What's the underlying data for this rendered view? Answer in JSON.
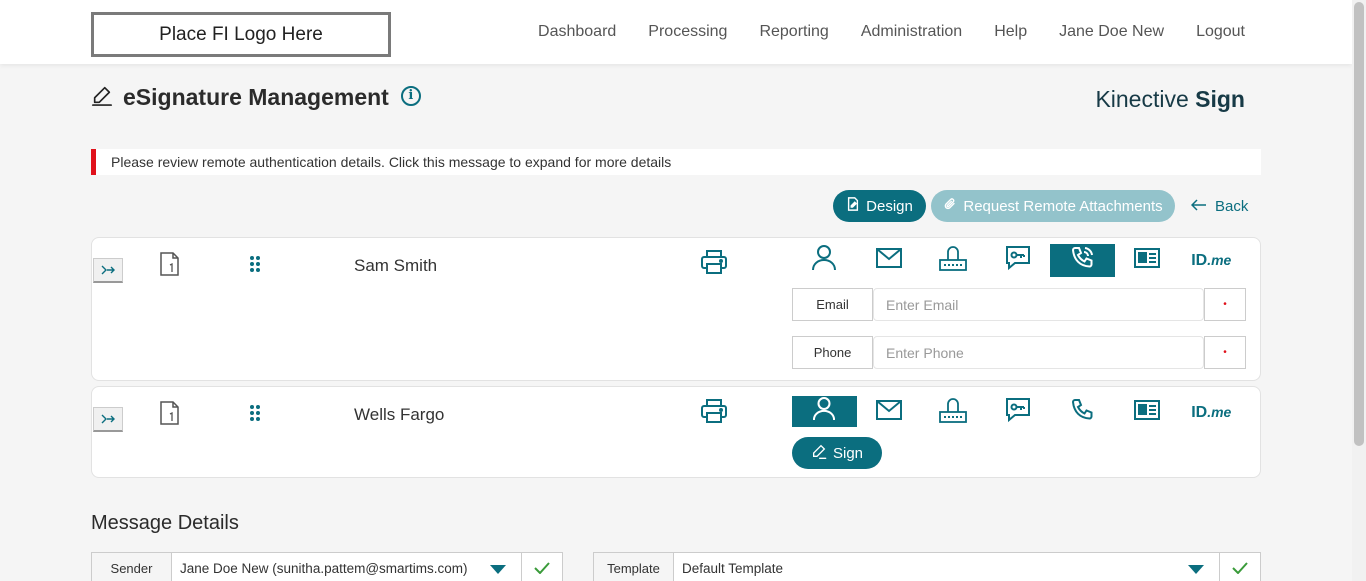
{
  "header": {
    "logo_text": "Place FI Logo Here",
    "nav": [
      "Dashboard",
      "Processing",
      "Reporting",
      "Administration",
      "Help",
      "Jane Doe New",
      "Logout"
    ]
  },
  "page": {
    "title": "eSignature Management",
    "brand_light": "Kinective ",
    "brand_bold": "Sign"
  },
  "alert": {
    "text": "Please review remote authentication details. Click this message to expand for more details",
    "color": "#e0111b"
  },
  "actions": {
    "design": "Design",
    "request_attachments": "Request Remote Attachments",
    "back": "Back"
  },
  "signers": [
    {
      "name": "Sam Smith",
      "active_auth": "phone",
      "fields": [
        {
          "label": "Email",
          "placeholder": "Enter Email"
        },
        {
          "label": "Phone",
          "placeholder": "Enter Phone"
        }
      ]
    },
    {
      "name": "Wells Fargo",
      "active_auth": "user",
      "sign_label": "Sign"
    }
  ],
  "auth_methods": [
    "user-icon",
    "email-icon",
    "router-icon",
    "sms-key-icon",
    "phone-icon",
    "id-card-icon",
    "idme-logo"
  ],
  "idme": {
    "id": "ID",
    "me": ".me"
  },
  "message_details": {
    "title": "Message Details",
    "sender_label": "Sender",
    "sender_value": "Jane Doe New (sunitha.pattem@smartims.com)",
    "template_label": "Template",
    "template_value": "Default Template"
  },
  "colors": {
    "accent": "#0b6e7f",
    "accent_disabled": "#93c3cb",
    "required": "#e0111b",
    "check": "#3a9b3a"
  }
}
